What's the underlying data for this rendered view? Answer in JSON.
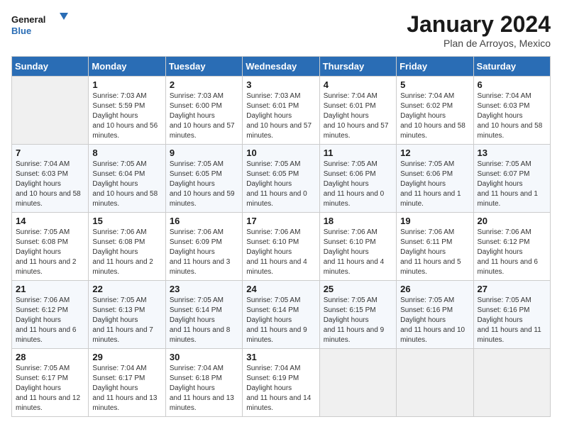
{
  "header": {
    "logo_general": "General",
    "logo_blue": "Blue",
    "month_year": "January 2024",
    "location": "Plan de Arroyos, Mexico"
  },
  "days_of_week": [
    "Sunday",
    "Monday",
    "Tuesday",
    "Wednesday",
    "Thursday",
    "Friday",
    "Saturday"
  ],
  "weeks": [
    [
      {
        "day": "",
        "empty": true
      },
      {
        "day": "1",
        "sunrise": "7:03 AM",
        "sunset": "5:59 PM",
        "daylight": "10 hours and 56 minutes."
      },
      {
        "day": "2",
        "sunrise": "7:03 AM",
        "sunset": "6:00 PM",
        "daylight": "10 hours and 57 minutes."
      },
      {
        "day": "3",
        "sunrise": "7:03 AM",
        "sunset": "6:01 PM",
        "daylight": "10 hours and 57 minutes."
      },
      {
        "day": "4",
        "sunrise": "7:04 AM",
        "sunset": "6:01 PM",
        "daylight": "10 hours and 57 minutes."
      },
      {
        "day": "5",
        "sunrise": "7:04 AM",
        "sunset": "6:02 PM",
        "daylight": "10 hours and 58 minutes."
      },
      {
        "day": "6",
        "sunrise": "7:04 AM",
        "sunset": "6:03 PM",
        "daylight": "10 hours and 58 minutes."
      }
    ],
    [
      {
        "day": "7",
        "sunrise": "7:04 AM",
        "sunset": "6:03 PM",
        "daylight": "10 hours and 58 minutes."
      },
      {
        "day": "8",
        "sunrise": "7:05 AM",
        "sunset": "6:04 PM",
        "daylight": "10 hours and 58 minutes."
      },
      {
        "day": "9",
        "sunrise": "7:05 AM",
        "sunset": "6:05 PM",
        "daylight": "10 hours and 59 minutes."
      },
      {
        "day": "10",
        "sunrise": "7:05 AM",
        "sunset": "6:05 PM",
        "daylight": "11 hours and 0 minutes."
      },
      {
        "day": "11",
        "sunrise": "7:05 AM",
        "sunset": "6:06 PM",
        "daylight": "11 hours and 0 minutes."
      },
      {
        "day": "12",
        "sunrise": "7:05 AM",
        "sunset": "6:06 PM",
        "daylight": "11 hours and 1 minute."
      },
      {
        "day": "13",
        "sunrise": "7:05 AM",
        "sunset": "6:07 PM",
        "daylight": "11 hours and 1 minute."
      }
    ],
    [
      {
        "day": "14",
        "sunrise": "7:05 AM",
        "sunset": "6:08 PM",
        "daylight": "11 hours and 2 minutes."
      },
      {
        "day": "15",
        "sunrise": "7:06 AM",
        "sunset": "6:08 PM",
        "daylight": "11 hours and 2 minutes."
      },
      {
        "day": "16",
        "sunrise": "7:06 AM",
        "sunset": "6:09 PM",
        "daylight": "11 hours and 3 minutes."
      },
      {
        "day": "17",
        "sunrise": "7:06 AM",
        "sunset": "6:10 PM",
        "daylight": "11 hours and 4 minutes."
      },
      {
        "day": "18",
        "sunrise": "7:06 AM",
        "sunset": "6:10 PM",
        "daylight": "11 hours and 4 minutes."
      },
      {
        "day": "19",
        "sunrise": "7:06 AM",
        "sunset": "6:11 PM",
        "daylight": "11 hours and 5 minutes."
      },
      {
        "day": "20",
        "sunrise": "7:06 AM",
        "sunset": "6:12 PM",
        "daylight": "11 hours and 6 minutes."
      }
    ],
    [
      {
        "day": "21",
        "sunrise": "7:06 AM",
        "sunset": "6:12 PM",
        "daylight": "11 hours and 6 minutes."
      },
      {
        "day": "22",
        "sunrise": "7:05 AM",
        "sunset": "6:13 PM",
        "daylight": "11 hours and 7 minutes."
      },
      {
        "day": "23",
        "sunrise": "7:05 AM",
        "sunset": "6:14 PM",
        "daylight": "11 hours and 8 minutes."
      },
      {
        "day": "24",
        "sunrise": "7:05 AM",
        "sunset": "6:14 PM",
        "daylight": "11 hours and 9 minutes."
      },
      {
        "day": "25",
        "sunrise": "7:05 AM",
        "sunset": "6:15 PM",
        "daylight": "11 hours and 9 minutes."
      },
      {
        "day": "26",
        "sunrise": "7:05 AM",
        "sunset": "6:16 PM",
        "daylight": "11 hours and 10 minutes."
      },
      {
        "day": "27",
        "sunrise": "7:05 AM",
        "sunset": "6:16 PM",
        "daylight": "11 hours and 11 minutes."
      }
    ],
    [
      {
        "day": "28",
        "sunrise": "7:05 AM",
        "sunset": "6:17 PM",
        "daylight": "11 hours and 12 minutes."
      },
      {
        "day": "29",
        "sunrise": "7:04 AM",
        "sunset": "6:17 PM",
        "daylight": "11 hours and 13 minutes."
      },
      {
        "day": "30",
        "sunrise": "7:04 AM",
        "sunset": "6:18 PM",
        "daylight": "11 hours and 13 minutes."
      },
      {
        "day": "31",
        "sunrise": "7:04 AM",
        "sunset": "6:19 PM",
        "daylight": "11 hours and 14 minutes."
      },
      {
        "day": "",
        "empty": true
      },
      {
        "day": "",
        "empty": true
      },
      {
        "day": "",
        "empty": true
      }
    ]
  ],
  "labels": {
    "sunrise": "Sunrise:",
    "sunset": "Sunset:",
    "daylight": "Daylight hours"
  }
}
